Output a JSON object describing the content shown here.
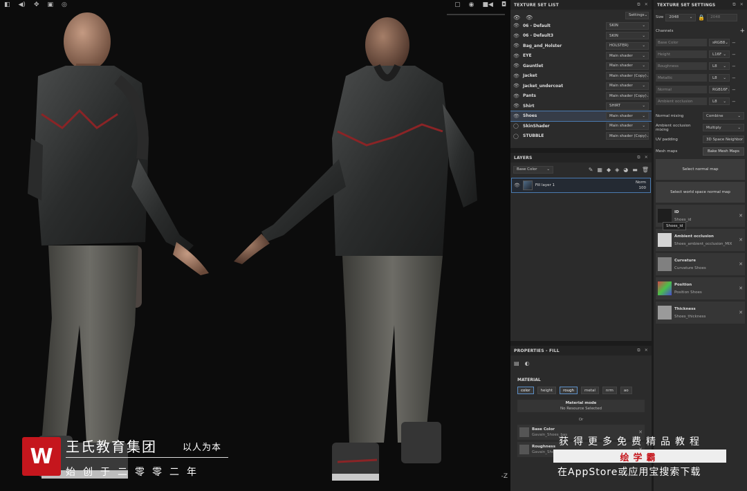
{
  "viewport": {
    "toolbar_left": [
      "◧",
      "◀)",
      "✥",
      "▣",
      "◎"
    ],
    "toolbar_right": [
      "▢",
      "◉",
      "■◀",
      "◘"
    ],
    "axis_label": "-Z"
  },
  "texture_set_list": {
    "title": "TEXTURE SET LIST",
    "settings_label": "Settings",
    "rows": [
      {
        "name": "06 - Default",
        "shader": "SKIN"
      },
      {
        "name": "06 - Default3",
        "shader": "SKIN"
      },
      {
        "name": "Bag_and_Holster",
        "shader": "HOLSTER)"
      },
      {
        "name": "EYE",
        "shader": "Main shader"
      },
      {
        "name": "Gauntlet",
        "shader": "Main shader"
      },
      {
        "name": "Jacket",
        "shader": "Main shader (Copy)"
      },
      {
        "name": "Jacket_undercoat",
        "shader": "Main shader"
      },
      {
        "name": "Pants",
        "shader": "Main shader (Copy)"
      },
      {
        "name": "Shirt",
        "shader": "SHIRT"
      },
      {
        "name": "Shoes",
        "shader": "Main shader"
      },
      {
        "name": "SkinShader",
        "shader": "Main shader"
      },
      {
        "name": "STUBBLE",
        "shader": "Main shader (Copy)"
      }
    ]
  },
  "layers": {
    "title": "LAYERS",
    "channel": "Base Color",
    "layer_name": "Fill layer 1",
    "blend": "Norm",
    "opacity": "100"
  },
  "properties": {
    "title": "PROPERTIES - FILL",
    "material_label": "MATERIAL",
    "chips": [
      "color",
      "height",
      "rough",
      "metal",
      "nrm",
      "ao"
    ],
    "material_mode": "Material mode",
    "no_resource": "No Resource Selected",
    "or": "Or",
    "slots": [
      {
        "title": "Base Color",
        "value": "Gavain_Shoes_bas"
      },
      {
        "title": "Roughness",
        "value": "Gavain_Shoes_Rou"
      }
    ]
  },
  "tss": {
    "title": "TEXTURE SET SETTINGS",
    "size_label": "Size",
    "size_value": "2048",
    "size_value2": "2048",
    "channels_label": "Channels",
    "channels": [
      {
        "name": "Base Color",
        "format": "sRGB8"
      },
      {
        "name": "Height",
        "format": "L16F"
      },
      {
        "name": "Roughness",
        "format": "L8"
      },
      {
        "name": "Metallic",
        "format": "L8"
      },
      {
        "name": "Normal",
        "format": "RGB16F"
      },
      {
        "name": "Ambient occlusion",
        "format": "L8"
      }
    ],
    "normal_mixing_label": "Normal mixing",
    "normal_mixing_value": "Combine",
    "ao_mixing_label": "Ambient occlusion mixing",
    "ao_mixing_value": "Multiply",
    "uv_padding_label": "UV padding",
    "uv_padding_value": "3D Space Neighbor",
    "mesh_maps_label": "Mesh maps",
    "bake_button": "Bake Mesh Maps",
    "select_normal": "Select normal map",
    "select_ws_normal": "Select world space normal map",
    "maps": [
      {
        "title": "ID",
        "file": "Shoes_id"
      },
      {
        "title": "Ambient occlusion",
        "file": "Shoes_ambient_occlusion_MIX"
      },
      {
        "title": "Curvature",
        "file": "Curvature Shoes"
      },
      {
        "title": "Position",
        "file": "Position Shoes"
      },
      {
        "title": "Thickness",
        "file": "Shoes_thickness"
      }
    ],
    "tooltip": "Shoes_id"
  },
  "watermark": {
    "title": "王氏教育集团",
    "slogan": "以人为本",
    "sub": "始创于二零零二年",
    "line1": "获得更多免费精品教程",
    "brand": "绘学霸",
    "line3": "在AppStore或应用宝搜索下载"
  },
  "colors": {
    "selection": "#4b7bb0",
    "brand_red": "#c5161d"
  }
}
